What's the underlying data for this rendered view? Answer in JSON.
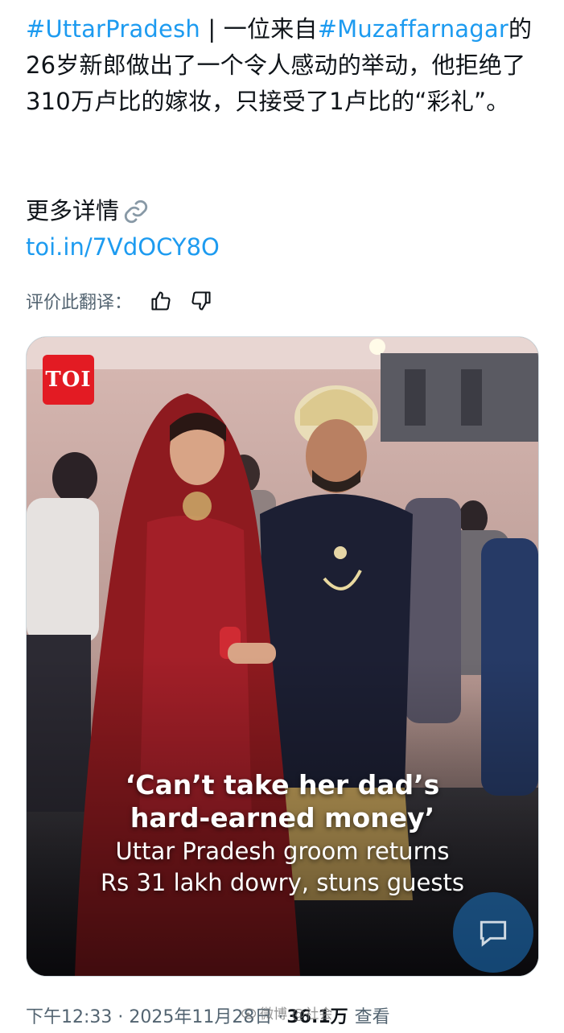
{
  "tweet": {
    "tag1": "#UttarPradesh",
    "sep1": " | 一位来自",
    "tag2": "#Muzaffarnagar",
    "body": "的26岁新郎做出了一个令人感动的举动，他拒绝了310万卢比的嫁妆，只接受了1卢比的“彩礼”。",
    "more": "更多详情",
    "more_icon": "link-icon",
    "link": "toi.in/7VdOCY8O",
    "rate_label": "评价此翻译："
  },
  "media": {
    "logo": "TOI",
    "headline_1": "‘Can’t take her dad’s",
    "headline_2": "hard-earned money’",
    "sub_1": "Uttar Pradesh groom returns",
    "sub_2": "Rs 31 lakh dowry, stuns guests"
  },
  "meta": {
    "time": "下午12:33 · 2025年11月28日 · ",
    "views": "36.1万",
    "views_label": "查看"
  },
  "watermark": "微博 @社会",
  "colors": {
    "link": "#1d9bf0",
    "secondary": "#536471",
    "toi_red": "#e31b23"
  }
}
